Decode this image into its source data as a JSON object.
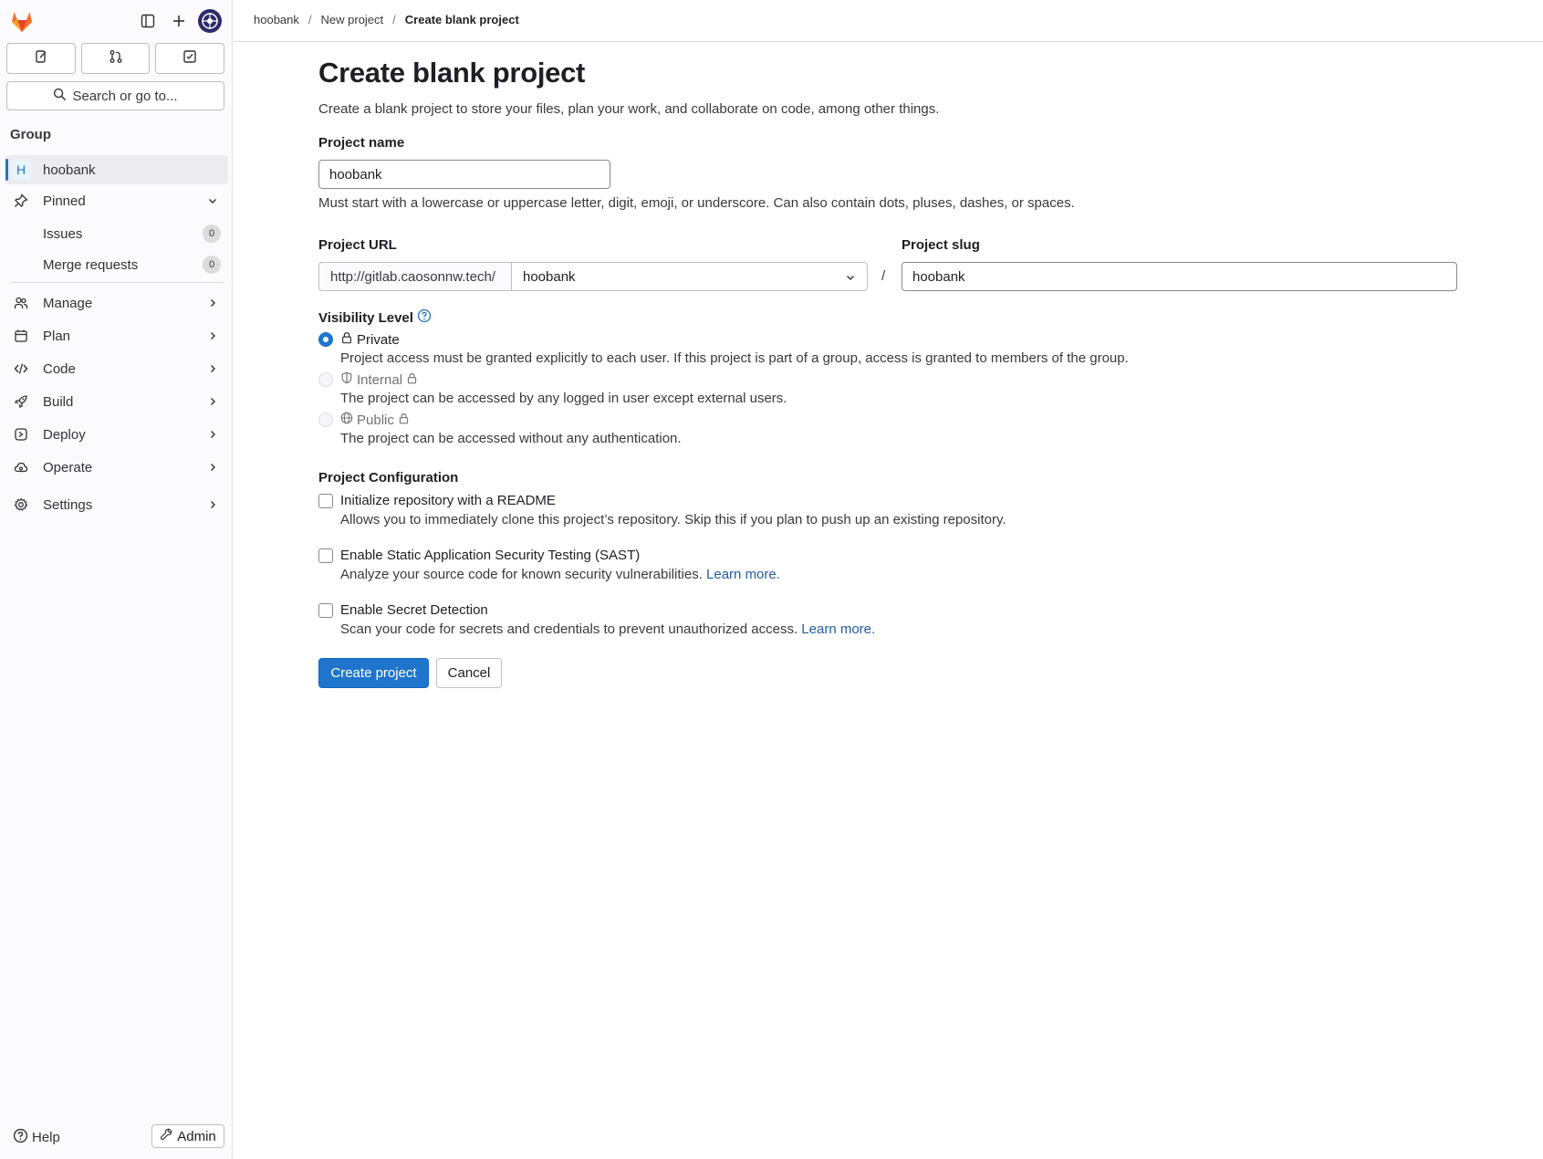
{
  "sidebar": {
    "top_icons": [
      "gitlab-logo",
      "sidebar-toggle-icon",
      "plus-icon",
      "user-avatar"
    ],
    "tabs": [
      "issues-icon",
      "merge-request-icon",
      "todo-icon"
    ],
    "search_label": "Search or go to...",
    "section_title": "Group",
    "group": {
      "letter": "H",
      "name": "hoobank"
    },
    "pinned": {
      "label": "Pinned"
    },
    "pinned_items": [
      {
        "label": "Issues",
        "count": "0"
      },
      {
        "label": "Merge requests",
        "count": "0"
      }
    ],
    "nav": [
      {
        "label": "Manage",
        "icon": "users-icon"
      },
      {
        "label": "Plan",
        "icon": "calendar-icon"
      },
      {
        "label": "Code",
        "icon": "code-icon"
      },
      {
        "label": "Build",
        "icon": "rocket-icon"
      },
      {
        "label": "Deploy",
        "icon": "deploy-icon"
      },
      {
        "label": "Operate",
        "icon": "cloud-icon"
      },
      {
        "label": "Settings",
        "icon": "gear-icon"
      }
    ],
    "help_label": "Help",
    "admin_label": "Admin"
  },
  "breadcrumbs": [
    "hoobank",
    "New project",
    "Create blank project"
  ],
  "page": {
    "title": "Create blank project",
    "description": "Create a blank project to store your files, plan your work, and collaborate on code, among other things."
  },
  "form": {
    "project_name_label": "Project name",
    "project_name_value": "hoobank",
    "project_name_help": "Must start with a lowercase or uppercase letter, digit, emoji, or underscore. Can also contain dots, pluses, dashes, or spaces.",
    "project_url_label": "Project URL",
    "url_prefix": "http://gitlab.caosonnw.tech/",
    "namespace_value": "hoobank",
    "slash": "/",
    "project_slug_label": "Project slug",
    "project_slug_value": "hoobank",
    "visibility_label": "Visibility Level",
    "visibility_options": [
      {
        "label": "Private",
        "desc": "Project access must be granted explicitly to each user. If this project is part of a group, access is granted to members of the group.",
        "selected": true,
        "disabled": false
      },
      {
        "label": "Internal",
        "desc": "The project can be accessed by any logged in user except external users.",
        "selected": false,
        "disabled": true
      },
      {
        "label": "Public",
        "desc": "The project can be accessed without any authentication.",
        "selected": false,
        "disabled": true
      }
    ],
    "config_label": "Project Configuration",
    "config_options": [
      {
        "label": "Initialize repository with a README",
        "desc": "Allows you to immediately clone this project’s repository. Skip this if you plan to push up an existing repository.",
        "link": ""
      },
      {
        "label": "Enable Static Application Security Testing (SAST)",
        "desc": "Analyze your source code for known security vulnerabilities.",
        "link": "Learn more."
      },
      {
        "label": "Enable Secret Detection",
        "desc": "Scan your code for secrets and credentials to prevent unauthorized access.",
        "link": "Learn more."
      }
    ],
    "create_button": "Create project",
    "cancel_button": "Cancel"
  },
  "colors": {
    "accent": "#1f75cb",
    "link": "#1f5ca8",
    "sidebar_bg": "#fbfafd",
    "logo": "#e24329"
  }
}
